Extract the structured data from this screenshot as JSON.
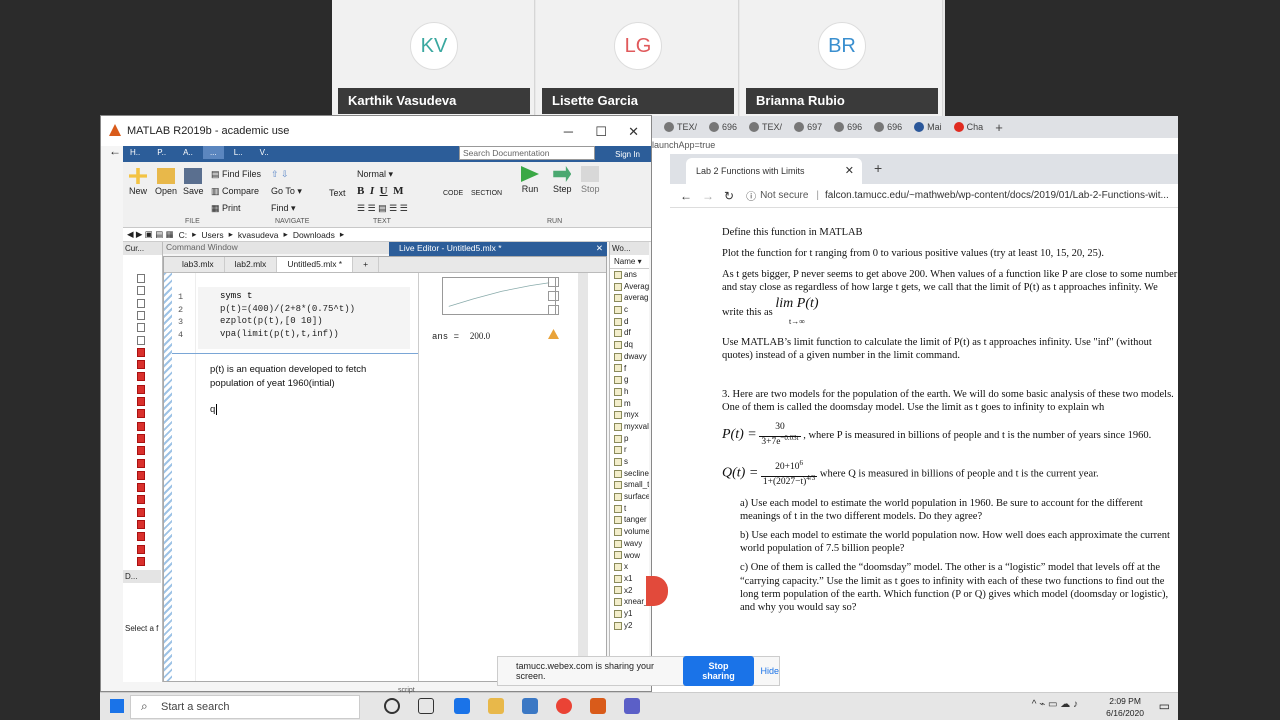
{
  "participants": [
    {
      "initials": "KV",
      "name": "Karthik Vasudeva",
      "color": "#3aa8a0"
    },
    {
      "initials": "LG",
      "name": "Lisette Garcia",
      "color": "#e0595b"
    },
    {
      "initials": "BR",
      "name": "Brianna Rubio",
      "color": "#3a8fcf"
    }
  ],
  "matlab": {
    "title": "MATLAB R2019b - academic use",
    "toolstrip_tabs": [
      "H..",
      "P..",
      "A..",
      "...",
      "L..",
      "V.."
    ],
    "search_placeholder": "Search Documentation",
    "signin": "Sign In",
    "ribbon": {
      "new": "New",
      "open": "Open",
      "save": "Save",
      "find_files": "Find Files",
      "compare": "Compare",
      "print": "Print",
      "goto": "Go To",
      "find": "Find",
      "text": "Text",
      "normal": "Normal",
      "bold": "B",
      "italic": "I",
      "underline": "U",
      "mono": "M",
      "code": "CODE",
      "section": "SECTION",
      "run": "Run",
      "step": "Step",
      "stop": "Stop",
      "sec_file": "FILE",
      "sec_navigate": "NAVIGATE",
      "sec_text": "TEXT",
      "sec_run": "RUN"
    },
    "path": [
      "C:",
      "Users",
      "kvasudeva",
      "Downloads"
    ],
    "current_folder_label": "Cur...",
    "details_label": "D...",
    "select_label": "Select a f",
    "command_window": "Command Window",
    "live_editor_title": "Live Editor - Untitled5.mlx *",
    "editor_tabs": [
      "lab3.mlx",
      "lab2.mlx",
      "Untitled5.mlx *"
    ],
    "code_lines": [
      "syms t",
      "p(t)=(400)/(2+8*(0.75^t))",
      "ezplot(p(t),[0 10])",
      "vpa(limit(p(t),t,inf))"
    ],
    "line_numbers": [
      "1",
      "2",
      "3",
      "4"
    ],
    "text_line1": "p(t) is an equation developed to fetch",
    "text_line2": "population of yeat 1960(intial)",
    "typed": "q",
    "ans_label": "ans =",
    "ans_value": "200.0",
    "workspace_label": "Wo...",
    "ws_name_header": "Name",
    "workspace": [
      "ans",
      "Averag",
      "averag",
      "c",
      "d",
      "df",
      "dq",
      "dwavy",
      "f",
      "g",
      "h",
      "m",
      "myx",
      "myxval",
      "p",
      "r",
      "s",
      "secline",
      "small_t",
      "surface",
      "t",
      "tanger",
      "volume",
      "wavy",
      "wow",
      "x",
      "x1",
      "x2",
      "xnear_",
      "y1",
      "y2"
    ]
  },
  "chrome": {
    "top_tabs": [
      "TEX/",
      "696",
      "TEX/",
      "697",
      "696",
      "696",
      "Mai",
      "Cha"
    ],
    "address_partial": "launchApp=true",
    "tab_title": "Lab 2 Functions with Limits",
    "not_secure": "Not secure",
    "url": "falcon.tamucc.edu/~mathweb/wp-content/docs/2019/01/Lab-2-Functions-wit...",
    "doc": {
      "p1": "Define this function in MATLAB",
      "p2": "Plot the function for t ranging from 0 to various positive values (try at least 10, 15, 20, 25).",
      "p3": "As t gets bigger, P never seems to get above 200.  When values of a function like P are close to some number and stay close as regardless of how large t gets, we call that the limit of P(t) as t approaches infinity.  We write this as",
      "lim": "lim P(t)",
      "lim_sub": "t→∞",
      "p4": "Use MATLAB’s limit function to calculate the limit of P(t) as t approaches infinity. Use \"inf\" (without quotes) instead of a given number in the limit command.",
      "p5": "3.  Here are two models for the population of the earth.  We will do some basic analysis of these two models.   One of them is called the doomsday model.  Use the limit as t goes to infinity to explain wh",
      "eq1_lhs": "P(t) =",
      "eq1_num": "30",
      "eq1_den": "3+7e",
      "eq1_exp": "−0.03t",
      "eq1_text": ",  where P is measured in billions of people and t is the number of years since 1960.",
      "eq2_lhs": "Q(t) =",
      "eq2_num": "20+10",
      "eq2_num_exp": "6",
      "eq2_den": "1+(2027−t)",
      "eq2_den_exp": "4/3",
      "eq2_text": "  where Q is measured in billions of people and t is the current year.",
      "a": "a)   Use each model to estimate the world population in 1960.  Be sure to account for the different meanings of t in the two different models.  Do they agree?",
      "b": "b)   Use each model to estimate the world population now.  How well does each approximate the current world population of 7.5 billion people?",
      "c": "c)   One of them is called the “doomsday” model.  The other is a “logistic” model that levels off at the “carrying capacity.”  Use the limit as t goes to infinity with each of these two functions to find out the long term population of the earth.  Which function (P or Q) gives which model (doomsday or logistic), and why you would say so?"
    }
  },
  "share": {
    "message": "tamucc.webex.com is sharing your screen.",
    "stop": "Stop sharing",
    "hide": "Hide"
  },
  "taskbar": {
    "search": "Start a search",
    "script_label": "script",
    "time": "2:09 PM",
    "date": "6/16/2020"
  }
}
